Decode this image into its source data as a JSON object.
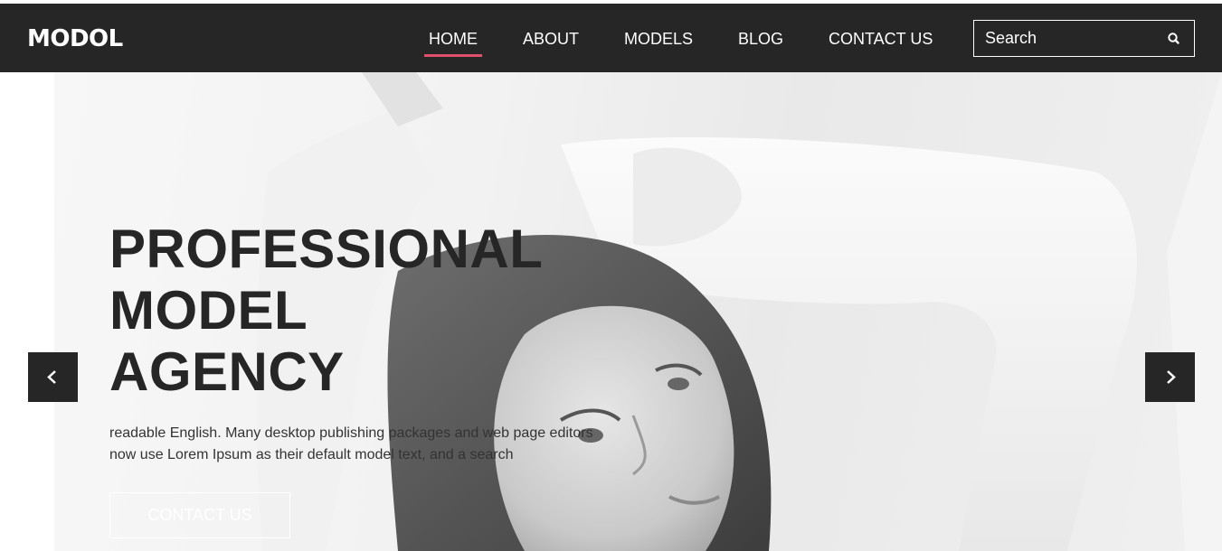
{
  "brand": {
    "logo": "MODOL"
  },
  "nav": {
    "items": [
      {
        "label": "HOME",
        "active": true
      },
      {
        "label": "ABOUT"
      },
      {
        "label": "MODELS"
      },
      {
        "label": "BLOG"
      },
      {
        "label": "CONTACT US"
      }
    ],
    "active_color": "#e0506a"
  },
  "search": {
    "placeholder": "Search",
    "icon": "search-icon"
  },
  "hero": {
    "headline_lines": [
      "PROFESSIONAL",
      "MODEL",
      "AGENCY"
    ],
    "description_lines": [
      "readable English. Many desktop publishing packages and web page editors",
      "now use Lorem Ipsum as their default model text, and a search"
    ],
    "cta_label": "CONTACT US",
    "prev_icon": "chevron-left-icon",
    "next_icon": "chevron-right-icon"
  },
  "colors": {
    "navbar": "#262626",
    "text_dark": "#262626",
    "accent": "#e0506a"
  }
}
